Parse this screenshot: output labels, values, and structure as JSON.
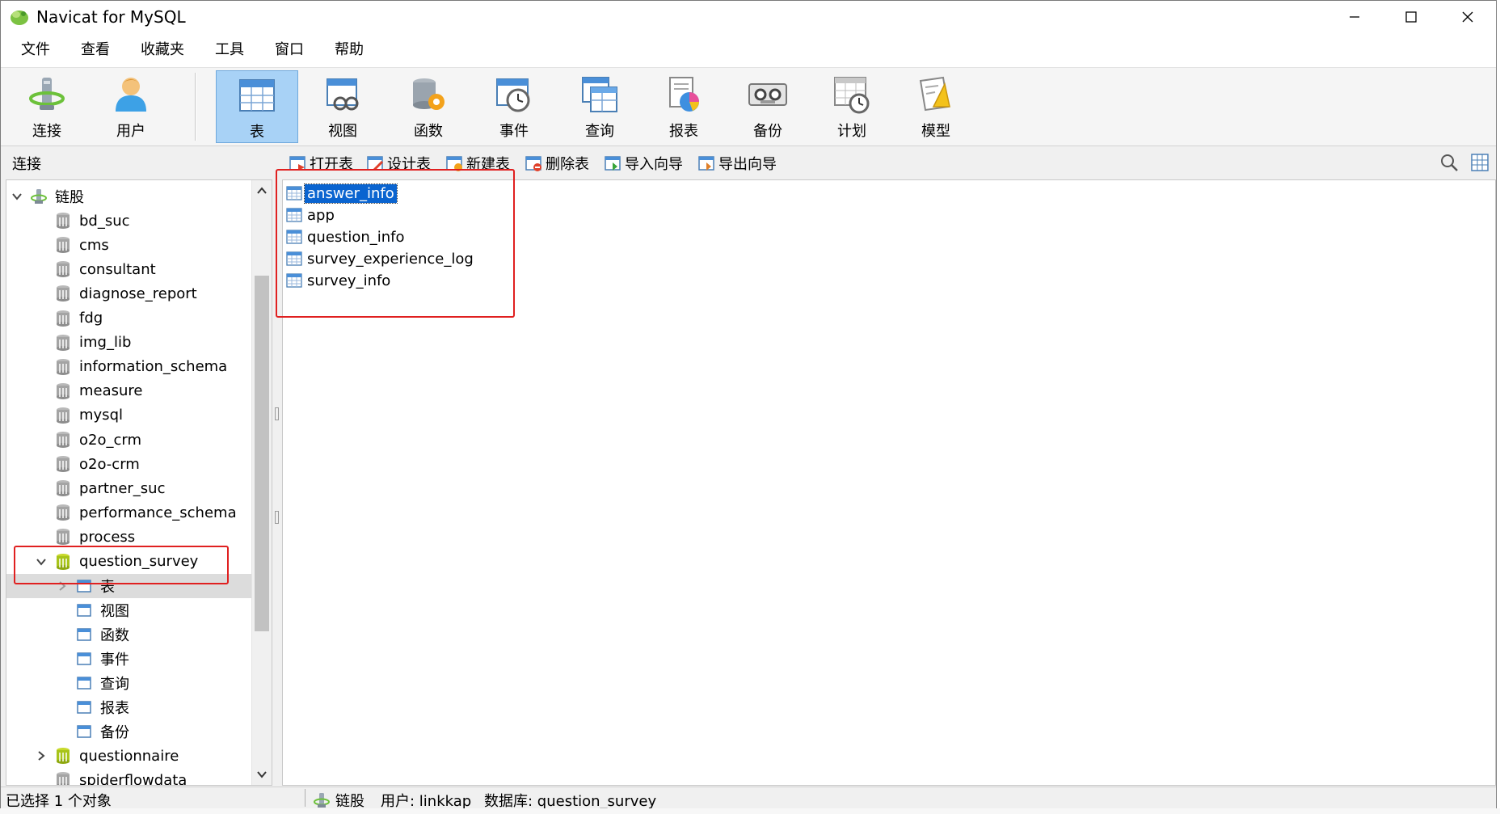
{
  "window": {
    "title": "Navicat for MySQL"
  },
  "menu": [
    "文件",
    "查看",
    "收藏夹",
    "工具",
    "窗口",
    "帮助"
  ],
  "toolbar": {
    "tools": [
      {
        "label": "连接",
        "icon": "connection-icon"
      },
      {
        "label": "用户",
        "icon": "user-icon"
      },
      {
        "label": "表",
        "icon": "table-icon",
        "active": true
      },
      {
        "label": "视图",
        "icon": "view-icon"
      },
      {
        "label": "函数",
        "icon": "function-icon"
      },
      {
        "label": "事件",
        "icon": "event-icon"
      },
      {
        "label": "查询",
        "icon": "query-icon"
      },
      {
        "label": "报表",
        "icon": "report-icon"
      },
      {
        "label": "备份",
        "icon": "backup-icon"
      },
      {
        "label": "计划",
        "icon": "schedule-icon"
      },
      {
        "label": "模型",
        "icon": "model-icon"
      }
    ]
  },
  "subbar": {
    "title": "连接",
    "actions": [
      "打开表",
      "设计表",
      "新建表",
      "删除表",
      "导入向导",
      "导出向导"
    ]
  },
  "tree": {
    "connection": "链股",
    "databases": [
      "bd_suc",
      "cms",
      "consultant",
      "diagnose_report",
      "fdg",
      "img_lib",
      "information_schema",
      "measure",
      "mysql",
      "o2o_crm",
      "o2o-crm",
      "partner_suc",
      "performance_schema",
      "process"
    ],
    "expanded_db": "question_survey",
    "children": [
      "表",
      "视图",
      "函数",
      "事件",
      "查询",
      "报表",
      "备份"
    ],
    "after": [
      "questionnaire",
      "spiderflowdata"
    ]
  },
  "tables": [
    "answer_info",
    "app",
    "question_info",
    "survey_experience_log",
    "survey_info"
  ],
  "status": {
    "selection": "已选择 1 个对象",
    "connection": "链股",
    "user": "用户: linkkap",
    "database": "数据库: question_survey"
  },
  "colors": {
    "selected": "#0a64d0",
    "active_tool": "#a8d2f6",
    "annotation": "#e02020"
  }
}
